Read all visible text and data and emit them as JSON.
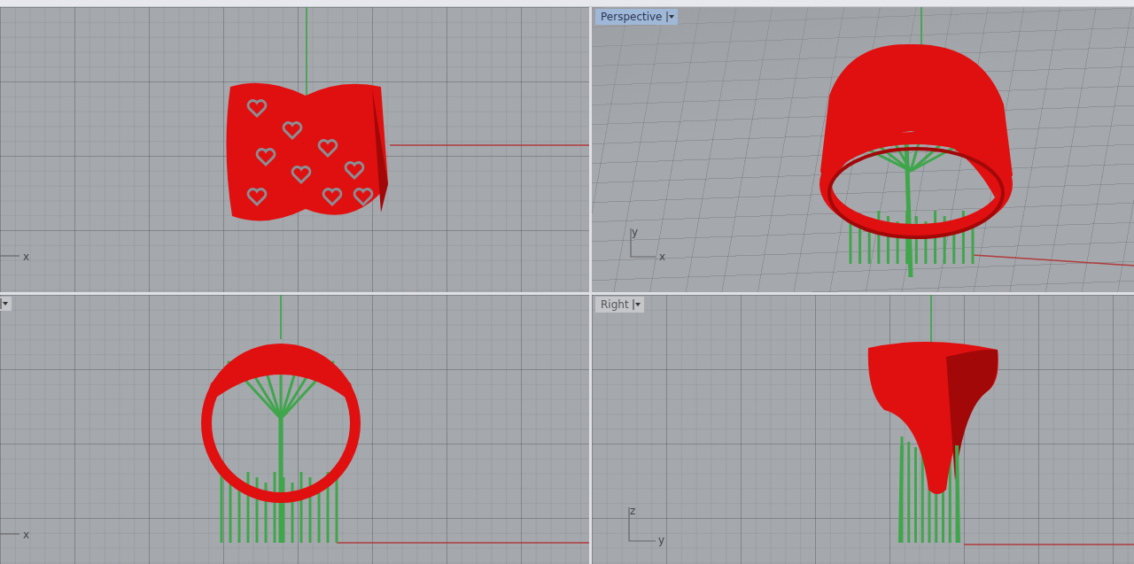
{
  "viewports": [
    {
      "kind": "front",
      "axes": [
        {
          "letter": "x",
          "kind": "horizontal"
        }
      ]
    },
    {
      "kind": "perspective",
      "tab": {
        "label": "Perspective",
        "cut": false,
        "selected": true
      },
      "axes": [
        {
          "letter": "y",
          "kind": "vertical"
        },
        {
          "letter": "x",
          "kind": "horizontal"
        }
      ]
    },
    {
      "kind": "top",
      "tab": {
        "cut": true,
        "selected": false
      },
      "axes": [
        {
          "letter": "x",
          "kind": "horizontal"
        }
      ]
    },
    {
      "kind": "right",
      "tab": {
        "label": "Right",
        "cut": false,
        "selected": false
      },
      "axes": [
        {
          "letter": "z",
          "kind": "vertical"
        },
        {
          "letter": "y",
          "kind": "horizontal"
        }
      ]
    }
  ]
}
